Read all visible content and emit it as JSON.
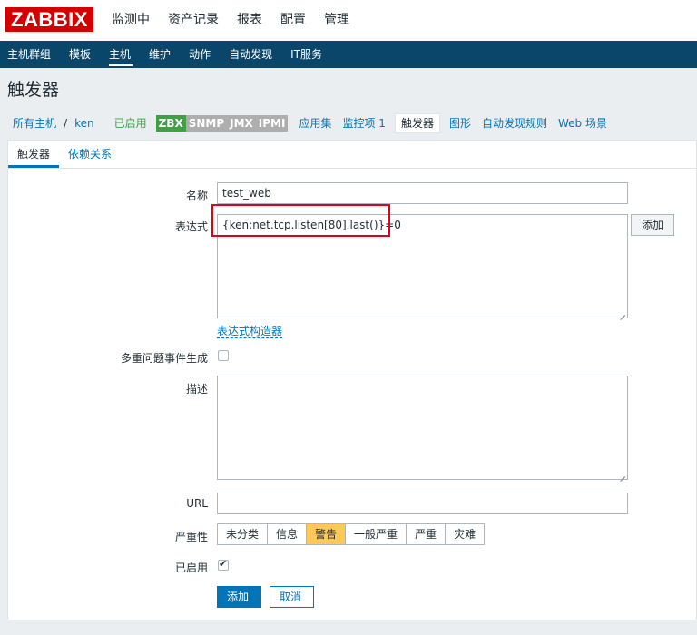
{
  "logo": "ZABBIX",
  "main_nav": [
    "监测中",
    "资产记录",
    "报表",
    "配置",
    "管理"
  ],
  "sub_nav": [
    "主机群组",
    "模板",
    "主机",
    "维护",
    "动作",
    "自动发现",
    "IT服务"
  ],
  "sub_nav_active": "主机",
  "page_title": "触发器",
  "host_nav": {
    "all_hosts": "所有主机",
    "separator": "/",
    "host": "ken",
    "status": "已启用",
    "badges": [
      "ZBX",
      "SNMP",
      "JMX",
      "IPMI"
    ],
    "applications": "应用集",
    "items": "监控项 1",
    "triggers": "触发器",
    "graphs": "图形",
    "discovery": "自动发现规则",
    "web": "Web 场景"
  },
  "form_tabs": [
    "触发器",
    "依赖关系"
  ],
  "form": {
    "name_label": "名称",
    "name_value": "test_web",
    "expression_label": "表达式",
    "expression_value": "{ken:net.tcp.listen[80].last()}=0",
    "add_expression_button": "添加",
    "expression_builder_link": "表达式构造器",
    "multiple_events_label": "多重问题事件生成",
    "multiple_events_checked": false,
    "description_label": "描述",
    "description_value": "",
    "url_label": "URL",
    "url_value": "",
    "severity_label": "严重性",
    "severity_options": [
      "未分类",
      "信息",
      "警告",
      "一般严重",
      "严重",
      "灾难"
    ],
    "severity_selected": "警告",
    "enabled_label": "已启用",
    "enabled_checked": true,
    "submit_button": "添加",
    "cancel_button": "取消"
  },
  "colors": {
    "header_nav": "#0a466a",
    "logo_bg": "#d40000",
    "link": "#0275b8",
    "enabled": "#429e47",
    "severity_selected": "#ffc859",
    "highlight_box": "#e0001b"
  }
}
